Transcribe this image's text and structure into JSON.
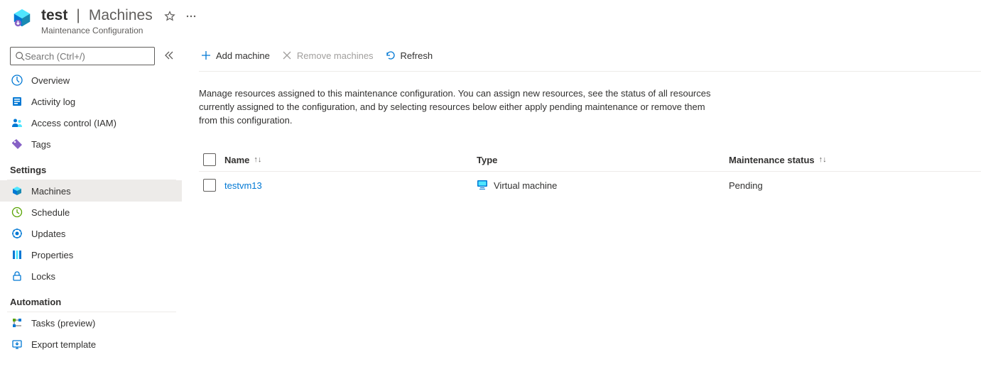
{
  "header": {
    "resource_name": "test",
    "section": "Machines",
    "subtitle": "Maintenance Configuration"
  },
  "search": {
    "placeholder": "Search (Ctrl+/)"
  },
  "sidebar": {
    "items": [
      {
        "label": "Overview"
      },
      {
        "label": "Activity log"
      },
      {
        "label": "Access control (IAM)"
      },
      {
        "label": "Tags"
      }
    ],
    "settings_label": "Settings",
    "settings_items": [
      {
        "label": "Machines"
      },
      {
        "label": "Schedule"
      },
      {
        "label": "Updates"
      },
      {
        "label": "Properties"
      },
      {
        "label": "Locks"
      }
    ],
    "automation_label": "Automation",
    "automation_items": [
      {
        "label": "Tasks (preview)"
      },
      {
        "label": "Export template"
      }
    ]
  },
  "toolbar": {
    "add_label": "Add machine",
    "remove_label": "Remove machines",
    "refresh_label": "Refresh"
  },
  "description": "Manage resources assigned to this maintenance configuration. You can assign new resources, see the status of all resources currently assigned to the configuration, and by selecting resources below either apply pending maintenance or remove them from this configuration.",
  "table": {
    "columns": {
      "name": "Name",
      "type": "Type",
      "status": "Maintenance status"
    },
    "rows": [
      {
        "name": "testvm13",
        "type": "Virtual machine",
        "status": "Pending"
      }
    ]
  }
}
